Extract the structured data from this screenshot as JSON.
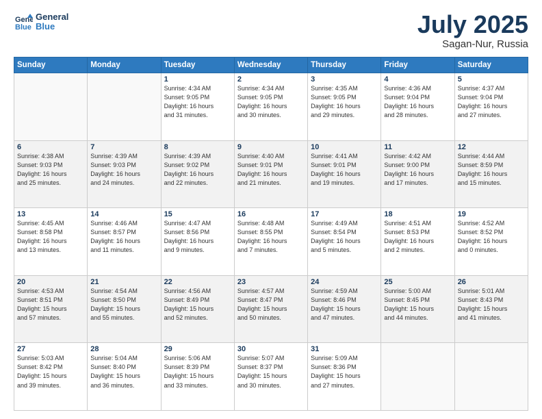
{
  "header": {
    "logo_line1": "General",
    "logo_line2": "Blue",
    "title": "July 2025",
    "location": "Sagan-Nur, Russia"
  },
  "days_of_week": [
    "Sunday",
    "Monday",
    "Tuesday",
    "Wednesday",
    "Thursday",
    "Friday",
    "Saturday"
  ],
  "weeks": [
    [
      {
        "day": "",
        "info": ""
      },
      {
        "day": "",
        "info": ""
      },
      {
        "day": "1",
        "info": "Sunrise: 4:34 AM\nSunset: 9:05 PM\nDaylight: 16 hours\nand 31 minutes."
      },
      {
        "day": "2",
        "info": "Sunrise: 4:34 AM\nSunset: 9:05 PM\nDaylight: 16 hours\nand 30 minutes."
      },
      {
        "day": "3",
        "info": "Sunrise: 4:35 AM\nSunset: 9:05 PM\nDaylight: 16 hours\nand 29 minutes."
      },
      {
        "day": "4",
        "info": "Sunrise: 4:36 AM\nSunset: 9:04 PM\nDaylight: 16 hours\nand 28 minutes."
      },
      {
        "day": "5",
        "info": "Sunrise: 4:37 AM\nSunset: 9:04 PM\nDaylight: 16 hours\nand 27 minutes."
      }
    ],
    [
      {
        "day": "6",
        "info": "Sunrise: 4:38 AM\nSunset: 9:03 PM\nDaylight: 16 hours\nand 25 minutes."
      },
      {
        "day": "7",
        "info": "Sunrise: 4:39 AM\nSunset: 9:03 PM\nDaylight: 16 hours\nand 24 minutes."
      },
      {
        "day": "8",
        "info": "Sunrise: 4:39 AM\nSunset: 9:02 PM\nDaylight: 16 hours\nand 22 minutes."
      },
      {
        "day": "9",
        "info": "Sunrise: 4:40 AM\nSunset: 9:01 PM\nDaylight: 16 hours\nand 21 minutes."
      },
      {
        "day": "10",
        "info": "Sunrise: 4:41 AM\nSunset: 9:01 PM\nDaylight: 16 hours\nand 19 minutes."
      },
      {
        "day": "11",
        "info": "Sunrise: 4:42 AM\nSunset: 9:00 PM\nDaylight: 16 hours\nand 17 minutes."
      },
      {
        "day": "12",
        "info": "Sunrise: 4:44 AM\nSunset: 8:59 PM\nDaylight: 16 hours\nand 15 minutes."
      }
    ],
    [
      {
        "day": "13",
        "info": "Sunrise: 4:45 AM\nSunset: 8:58 PM\nDaylight: 16 hours\nand 13 minutes."
      },
      {
        "day": "14",
        "info": "Sunrise: 4:46 AM\nSunset: 8:57 PM\nDaylight: 16 hours\nand 11 minutes."
      },
      {
        "day": "15",
        "info": "Sunrise: 4:47 AM\nSunset: 8:56 PM\nDaylight: 16 hours\nand 9 minutes."
      },
      {
        "day": "16",
        "info": "Sunrise: 4:48 AM\nSunset: 8:55 PM\nDaylight: 16 hours\nand 7 minutes."
      },
      {
        "day": "17",
        "info": "Sunrise: 4:49 AM\nSunset: 8:54 PM\nDaylight: 16 hours\nand 5 minutes."
      },
      {
        "day": "18",
        "info": "Sunrise: 4:51 AM\nSunset: 8:53 PM\nDaylight: 16 hours\nand 2 minutes."
      },
      {
        "day": "19",
        "info": "Sunrise: 4:52 AM\nSunset: 8:52 PM\nDaylight: 16 hours\nand 0 minutes."
      }
    ],
    [
      {
        "day": "20",
        "info": "Sunrise: 4:53 AM\nSunset: 8:51 PM\nDaylight: 15 hours\nand 57 minutes."
      },
      {
        "day": "21",
        "info": "Sunrise: 4:54 AM\nSunset: 8:50 PM\nDaylight: 15 hours\nand 55 minutes."
      },
      {
        "day": "22",
        "info": "Sunrise: 4:56 AM\nSunset: 8:49 PM\nDaylight: 15 hours\nand 52 minutes."
      },
      {
        "day": "23",
        "info": "Sunrise: 4:57 AM\nSunset: 8:47 PM\nDaylight: 15 hours\nand 50 minutes."
      },
      {
        "day": "24",
        "info": "Sunrise: 4:59 AM\nSunset: 8:46 PM\nDaylight: 15 hours\nand 47 minutes."
      },
      {
        "day": "25",
        "info": "Sunrise: 5:00 AM\nSunset: 8:45 PM\nDaylight: 15 hours\nand 44 minutes."
      },
      {
        "day": "26",
        "info": "Sunrise: 5:01 AM\nSunset: 8:43 PM\nDaylight: 15 hours\nand 41 minutes."
      }
    ],
    [
      {
        "day": "27",
        "info": "Sunrise: 5:03 AM\nSunset: 8:42 PM\nDaylight: 15 hours\nand 39 minutes."
      },
      {
        "day": "28",
        "info": "Sunrise: 5:04 AM\nSunset: 8:40 PM\nDaylight: 15 hours\nand 36 minutes."
      },
      {
        "day": "29",
        "info": "Sunrise: 5:06 AM\nSunset: 8:39 PM\nDaylight: 15 hours\nand 33 minutes."
      },
      {
        "day": "30",
        "info": "Sunrise: 5:07 AM\nSunset: 8:37 PM\nDaylight: 15 hours\nand 30 minutes."
      },
      {
        "day": "31",
        "info": "Sunrise: 5:09 AM\nSunset: 8:36 PM\nDaylight: 15 hours\nand 27 minutes."
      },
      {
        "day": "",
        "info": ""
      },
      {
        "day": "",
        "info": ""
      }
    ]
  ]
}
